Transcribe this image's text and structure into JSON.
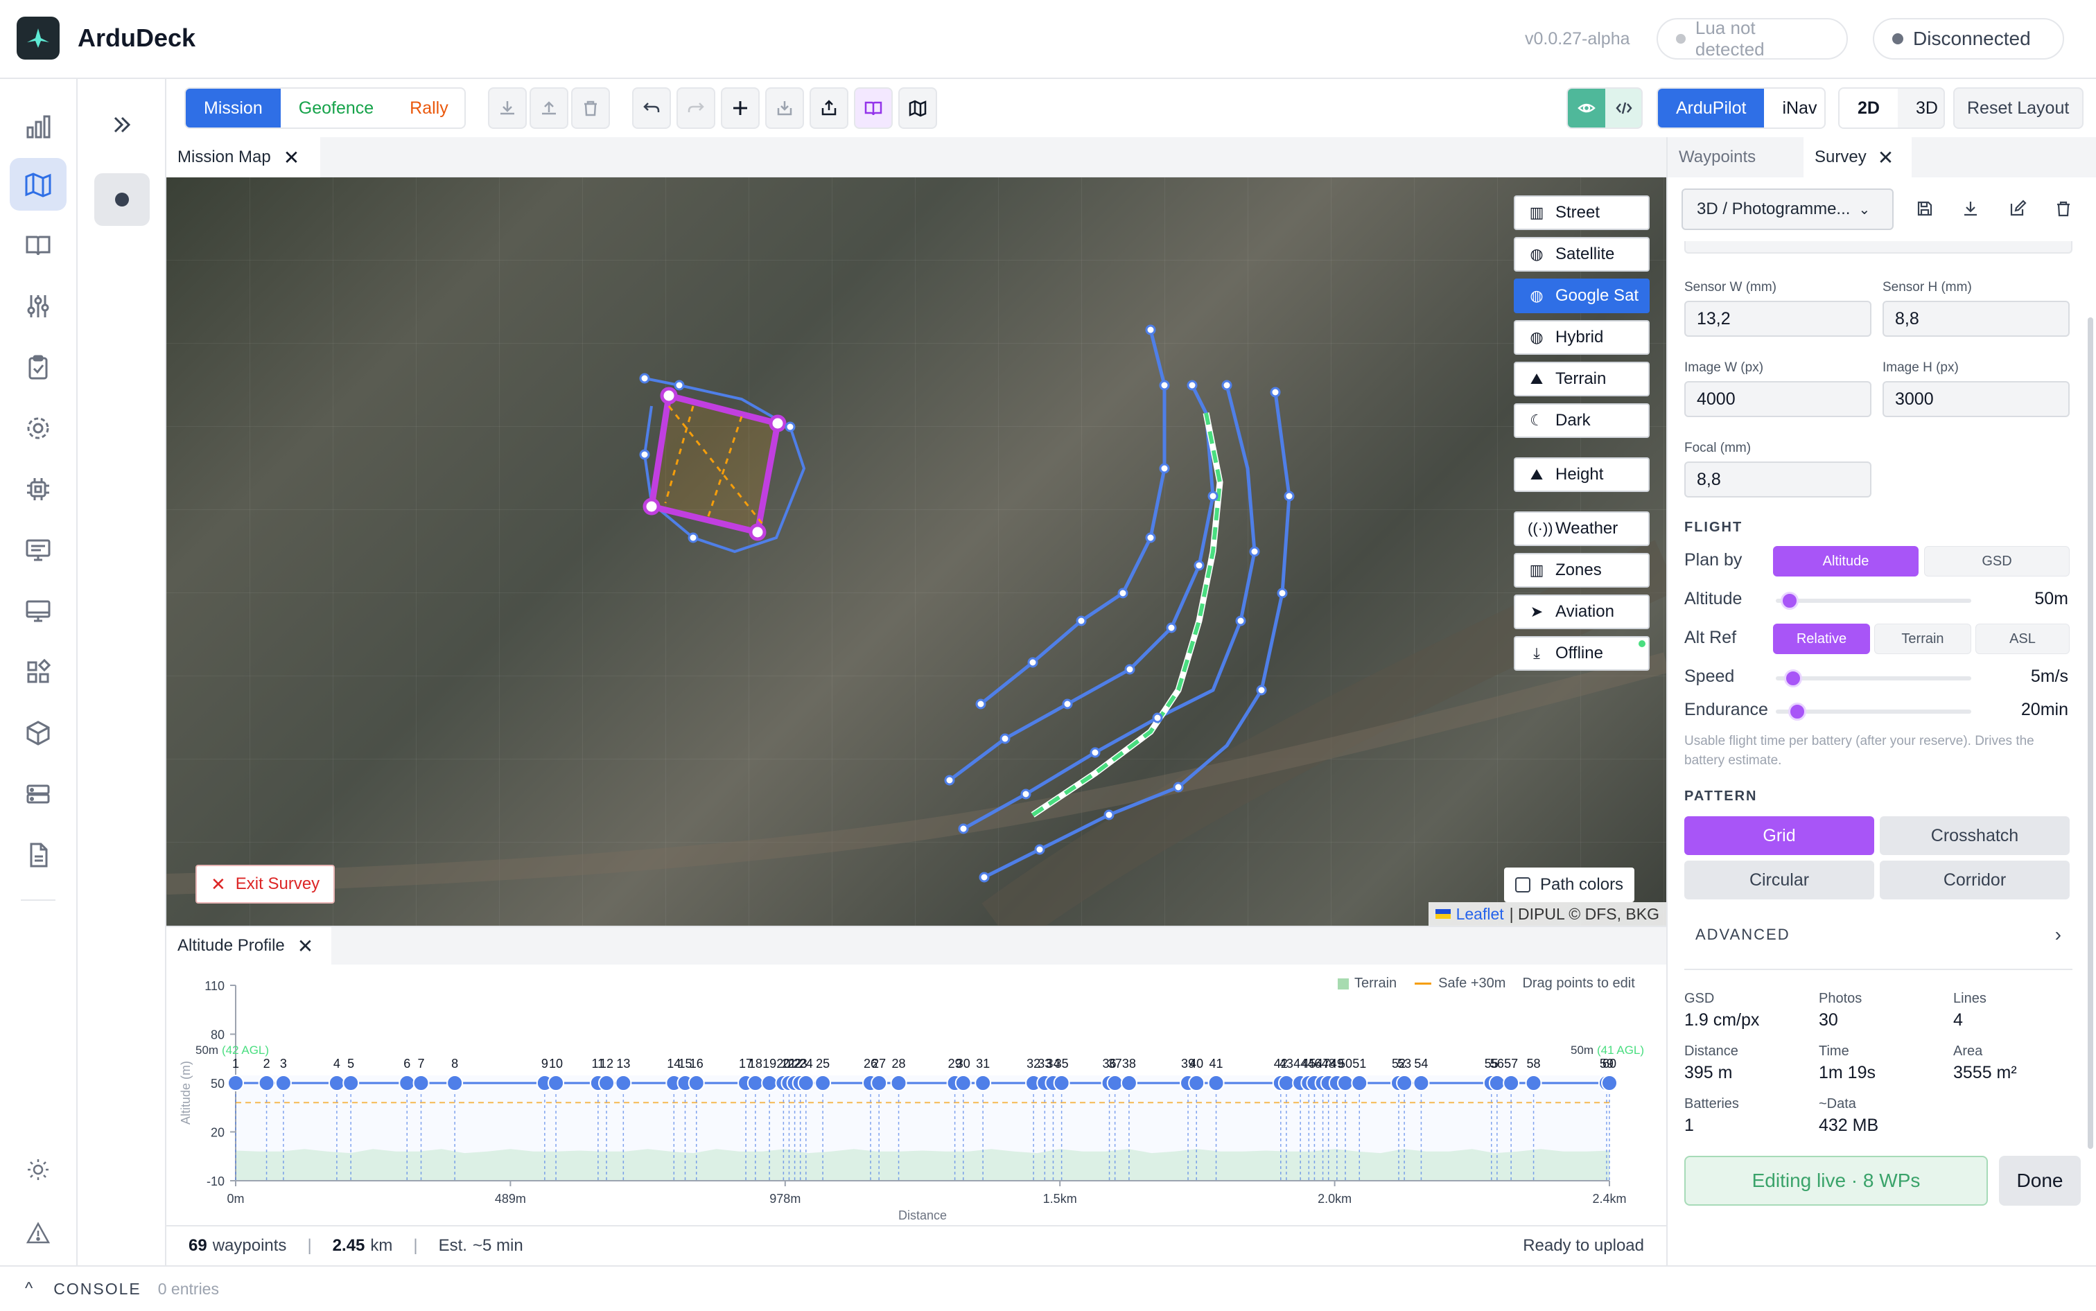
{
  "app": {
    "title": "ArduDeck",
    "version": "v0.0.27-alpha",
    "lua_status": "Lua not detected",
    "connection_status": "Disconnected"
  },
  "toolbar": {
    "mode_tabs": [
      "Mission",
      "Geofence",
      "Rally"
    ],
    "firmware": [
      "ArduPilot",
      "iNav"
    ],
    "view_modes": [
      "2D",
      "3D"
    ],
    "reset_layout": "Reset Layout"
  },
  "map_panel": {
    "tab_label": "Mission Map",
    "layers": [
      "Street",
      "Satellite",
      "Google Sat",
      "Hybrid",
      "Terrain",
      "Dark",
      "Height",
      "Weather",
      "Zones",
      "Aviation",
      "Offline"
    ],
    "active_layer": "Google Sat",
    "exit_survey": "Exit Survey",
    "path_colors": "Path colors",
    "attribution_link": "Leaflet",
    "attribution_rest": "| DIPUL © DFS, BKG"
  },
  "altitude_profile": {
    "tab_label": "Altitude Profile",
    "legend_terrain": "Terrain",
    "legend_safe": "Safe +30m",
    "drag_hint": "Drag points to edit",
    "y_label": "Altitude (m)",
    "x_label": "Distance",
    "start_note_main": "50m",
    "start_note_agl": "(42 AGL)",
    "end_note_main": "50m",
    "end_note_agl": "(41 AGL)"
  },
  "chart_data": {
    "type": "line",
    "title": "",
    "xlabel": "Distance",
    "ylabel": "Altitude (m)",
    "yticks": [
      110,
      80,
      50,
      20,
      -10
    ],
    "ylim": [
      -10,
      110
    ],
    "xtick_labels": [
      "0m",
      "489m",
      "978m",
      "1.5km",
      "2.0km",
      "2.4km"
    ],
    "xtick_values_m": [
      0,
      489,
      978,
      1467,
      1956,
      2445
    ],
    "series": [
      {
        "name": "",
        "altitude_m": 50
      },
      {
        "name": "Safe +30m",
        "altitude_m": 38
      },
      {
        "name": "Terrain",
        "altitude_m": 8
      }
    ],
    "waypoint_labels": [
      "1",
      "2",
      "3",
      "4",
      "5",
      "6",
      "7",
      "8",
      "9",
      "10",
      "11",
      "12",
      "13",
      "14",
      "15",
      "16",
      "17",
      "18",
      "19",
      "20",
      "21",
      "22",
      "23",
      "24",
      "25",
      "26",
      "27",
      "28",
      "29",
      "30",
      "31",
      "32",
      "33",
      "34",
      "35",
      "36",
      "37",
      "38",
      "39",
      "40",
      "41",
      "42",
      "43",
      "44",
      "45",
      "46",
      "47",
      "48",
      "49",
      "50",
      "51",
      "52",
      "53",
      "54",
      "55",
      "56",
      "57",
      "58",
      "59",
      "60"
    ],
    "waypoint_distance_m": [
      0,
      55,
      85,
      180,
      205,
      305,
      330,
      390,
      550,
      570,
      645,
      660,
      690,
      780,
      800,
      820,
      908,
      925,
      950,
      975,
      985,
      995,
      1005,
      1015,
      1045,
      1130,
      1145,
      1180,
      1280,
      1295,
      1330,
      1420,
      1440,
      1455,
      1470,
      1555,
      1565,
      1590,
      1695,
      1710,
      1745,
      1860,
      1870,
      1895,
      1910,
      1920,
      1935,
      1945,
      1960,
      1975,
      2000,
      2070,
      2080,
      2110,
      2235,
      2245,
      2270,
      2310,
      2440,
      2445
    ]
  },
  "footer": {
    "waypoints_count": "69",
    "waypoints_label": "waypoints",
    "distance_value": "2.45",
    "distance_unit": "km",
    "est_label": "Est.",
    "est_value": "~5 min",
    "status": "Ready to upload"
  },
  "survey_panel": {
    "tabs": [
      "Waypoints",
      "Survey"
    ],
    "preset": "3D / Photogramme...",
    "sensor_w_label": "Sensor W (mm)",
    "sensor_w": "13,2",
    "sensor_h_label": "Sensor H (mm)",
    "sensor_h": "8,8",
    "image_w_label": "Image W (px)",
    "image_w": "4000",
    "image_h_label": "Image H (px)",
    "image_h": "3000",
    "focal_label": "Focal (mm)",
    "focal": "8,8",
    "flight_section": "FLIGHT",
    "plan_by_label": "Plan by",
    "plan_by_options": [
      "Altitude",
      "GSD"
    ],
    "altitude_label": "Altitude",
    "altitude_value": "50m",
    "altitude_fraction": 0.07,
    "alt_ref_label": "Alt Ref",
    "alt_ref_options": [
      "Relative",
      "Terrain",
      "ASL"
    ],
    "speed_label": "Speed",
    "speed_value": "5m/s",
    "speed_fraction": 0.09,
    "endurance_label": "Endurance",
    "endurance_value": "20min",
    "endurance_fraction": 0.11,
    "endurance_help": "Usable flight time per battery (after your reserve). Drives the battery estimate.",
    "pattern_section": "PATTERN",
    "patterns": [
      "Grid",
      "Crosshatch",
      "Circular",
      "Corridor"
    ],
    "active_pattern": "Grid",
    "advanced_label": "ADVANCED",
    "stats": {
      "gsd_label": "GSD",
      "gsd": "1.9 cm/px",
      "photos_label": "Photos",
      "photos": "30",
      "lines_label": "Lines",
      "lines": "4",
      "distance_label": "Distance",
      "distance": "395 m",
      "time_label": "Time",
      "time": "1m 19s",
      "area_label": "Area",
      "area": "3555 m²",
      "batteries_label": "Batteries",
      "batteries": "1",
      "data_label": "~Data",
      "data": "432 MB"
    },
    "editing_live": "Editing live · 8 WPs",
    "done": "Done"
  },
  "console": {
    "label": "CONSOLE",
    "entries": "0 entries"
  },
  "colors": {
    "accent_blue": "#2f6fe6",
    "accent_purple": "#a855f7",
    "waypoint_blue": "#4f7fe8",
    "survey_magenta": "#c13fe0",
    "route_green": "#4ade80",
    "terrain_green": "#c6ebc9",
    "safe_orange": "#f59e0b"
  }
}
